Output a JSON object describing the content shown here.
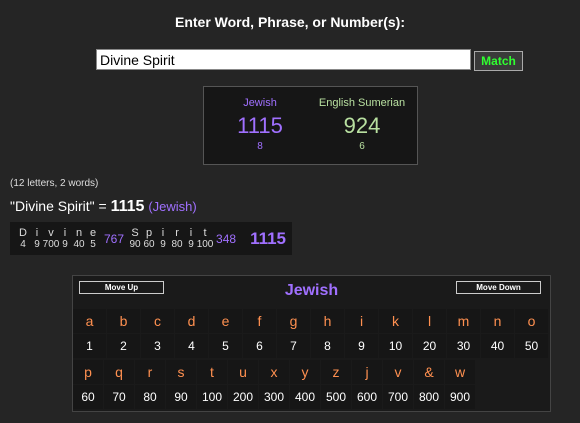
{
  "prompt": "Enter Word, Phrase, or Number(s):",
  "search": {
    "value": "Divine Spirit"
  },
  "match_label": "Match",
  "scores": {
    "jewish": {
      "name": "Jewish",
      "value": "1115",
      "sub": "8"
    },
    "sumerian": {
      "name": "English Sumerian",
      "value": "924",
      "sub": "6"
    }
  },
  "counts": "(12 letters, 2 words)",
  "result": {
    "phrase": "\"Divine Spirit\"",
    "eq": " = ",
    "value": "1115",
    "cipher": "(Jewish)"
  },
  "breakdown": {
    "word1": [
      [
        "D",
        "4"
      ],
      [
        "i",
        "9"
      ],
      [
        "v",
        "700"
      ],
      [
        "i",
        "9"
      ],
      [
        "n",
        "40"
      ],
      [
        "e",
        "5"
      ]
    ],
    "word1_sum": "767",
    "word2": [
      [
        "S",
        "90"
      ],
      [
        "p",
        "60"
      ],
      [
        "i",
        "9"
      ],
      [
        "r",
        "80"
      ],
      [
        "i",
        "9"
      ],
      [
        "t",
        "100"
      ]
    ],
    "word2_sum": "348",
    "total": "1115"
  },
  "cipher_table": {
    "move_up": "Move Up",
    "move_down": "Move Down",
    "title": "Jewish",
    "row1_letters": [
      "a",
      "b",
      "c",
      "d",
      "e",
      "f",
      "g",
      "h",
      "i",
      "k",
      "l",
      "m",
      "n",
      "o"
    ],
    "row1_values": [
      "1",
      "2",
      "3",
      "4",
      "5",
      "6",
      "7",
      "8",
      "9",
      "10",
      "20",
      "30",
      "40",
      "50"
    ],
    "row2_letters": [
      "p",
      "q",
      "r",
      "s",
      "t",
      "u",
      "x",
      "y",
      "z",
      "j",
      "v",
      "&",
      "w"
    ],
    "row2_values": [
      "60",
      "70",
      "80",
      "90",
      "100",
      "200",
      "300",
      "400",
      "500",
      "600",
      "700",
      "800",
      "900"
    ]
  }
}
